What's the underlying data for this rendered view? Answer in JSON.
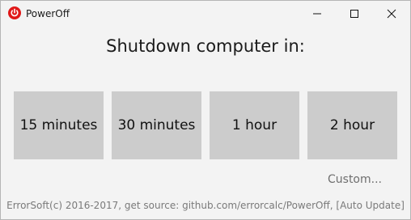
{
  "window": {
    "title": "PowerOff",
    "controls": [
      "minimize-icon",
      "maximize-icon",
      "close-icon"
    ],
    "icon": "power-icon",
    "icon_color": "#e01818"
  },
  "main": {
    "heading": "Shutdown computer in:",
    "options": [
      {
        "label": "15 minutes"
      },
      {
        "label": "30 minutes"
      },
      {
        "label": "1 hour"
      },
      {
        "label": "2 hour"
      }
    ],
    "custom_label": "Custom..."
  },
  "footer": {
    "text": "ErrorSoft(c) 2016-2017, get source: github.com/errorcalc/PowerOff, [Auto Update]"
  },
  "colors": {
    "background": "#f3f3f3",
    "button_bg": "#cccccc",
    "muted_text": "#7a7a7a"
  }
}
